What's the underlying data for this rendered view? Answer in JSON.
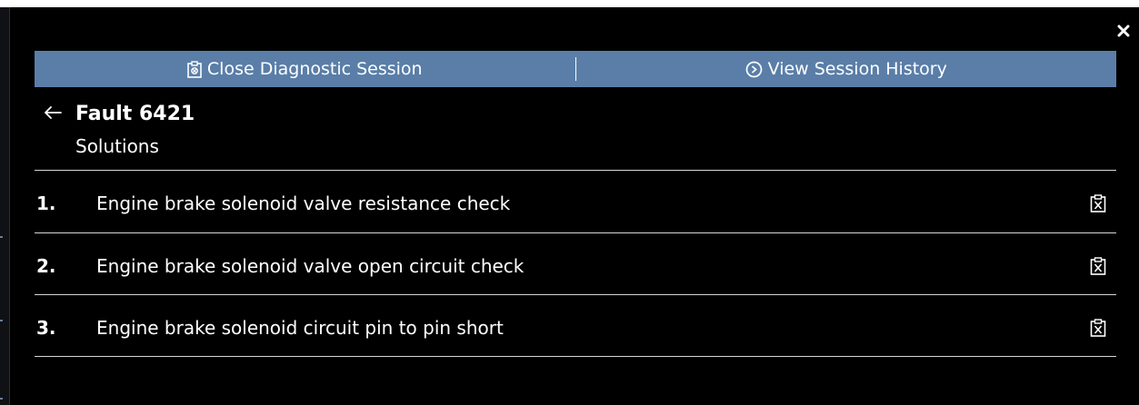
{
  "window": {
    "close_glyph": "✕"
  },
  "action_bar": {
    "close_session_label": "Close Diagnostic Session",
    "close_session_icon": "clipboard-icon",
    "view_history_label": "View Session History",
    "view_history_icon": "circle-chevron-icon",
    "background_color": "#5a7ea8"
  },
  "header": {
    "back_icon": "back-arrow-icon",
    "title": "Fault 6421",
    "subtitle": "Solutions"
  },
  "solutions": [
    {
      "number": "1.",
      "label": "Engine brake solenoid valve resistance check",
      "icon": "clipboard-x-icon"
    },
    {
      "number": "2.",
      "label": "Engine brake solenoid valve open circuit check",
      "icon": "clipboard-x-icon"
    },
    {
      "number": "3.",
      "label": "Engine brake solenoid circuit pin to pin short",
      "icon": "clipboard-x-icon"
    }
  ]
}
